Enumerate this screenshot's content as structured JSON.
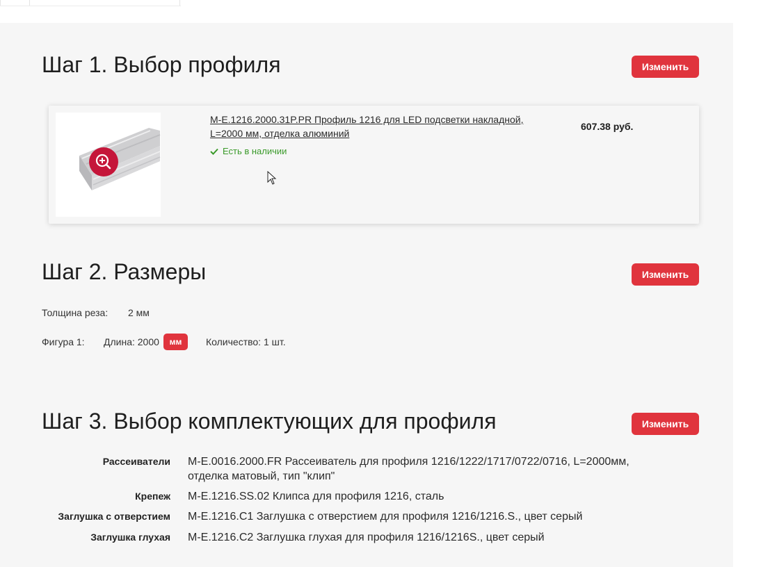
{
  "step1": {
    "title": "Шаг 1. Выбор профиля",
    "change_label": "Изменить",
    "product": {
      "name": "M-E.1216.2000.31P.PR Профиль 1216 для LED подсветки накладной, L=2000 мм, отделка алюминий",
      "stock": "Есть в наличии",
      "price": "607.38 руб."
    }
  },
  "step2": {
    "title": "Шаг 2. Размеры",
    "change_label": "Изменить",
    "cut_label": "Толщина реза:",
    "cut_value": "2 мм",
    "figure_label": "Фигура 1:",
    "length_text": "Длина: 2000",
    "unit": "мм",
    "quantity_text": "Количество: 1 шт."
  },
  "step3": {
    "title": "Шаг 3. Выбор комплектующих для профиля",
    "change_label": "Изменить",
    "items": [
      {
        "label": "Рассеиватели",
        "value": "M-E.0016.2000.FR Рассеиватель для профиля 1216/1222/1717/0722/0716, L=2000мм, отделка матовый, тип \"клип\""
      },
      {
        "label": "Крепеж",
        "value": "M-E.1216.SS.02 Клипса для профиля 1216, сталь"
      },
      {
        "label": "Заглушка с отверстием",
        "value": "M-E.1216.C1 Заглушка с отверстием для профиля 1216/1216.S., цвет серый"
      },
      {
        "label": "Заглушка глухая",
        "value": "M-E.1216.C2 Заглушка глухая для профиля 1216/1216S., цвет серый"
      }
    ]
  },
  "colors": {
    "accent": "#e0343d",
    "zoom": "#c5163a",
    "in_stock": "#3a9a2a",
    "panel_bg": "#f6f6f6"
  },
  "icons": [
    "zoom-in-icon",
    "checkmark-icon",
    "mouse-cursor-icon"
  ]
}
